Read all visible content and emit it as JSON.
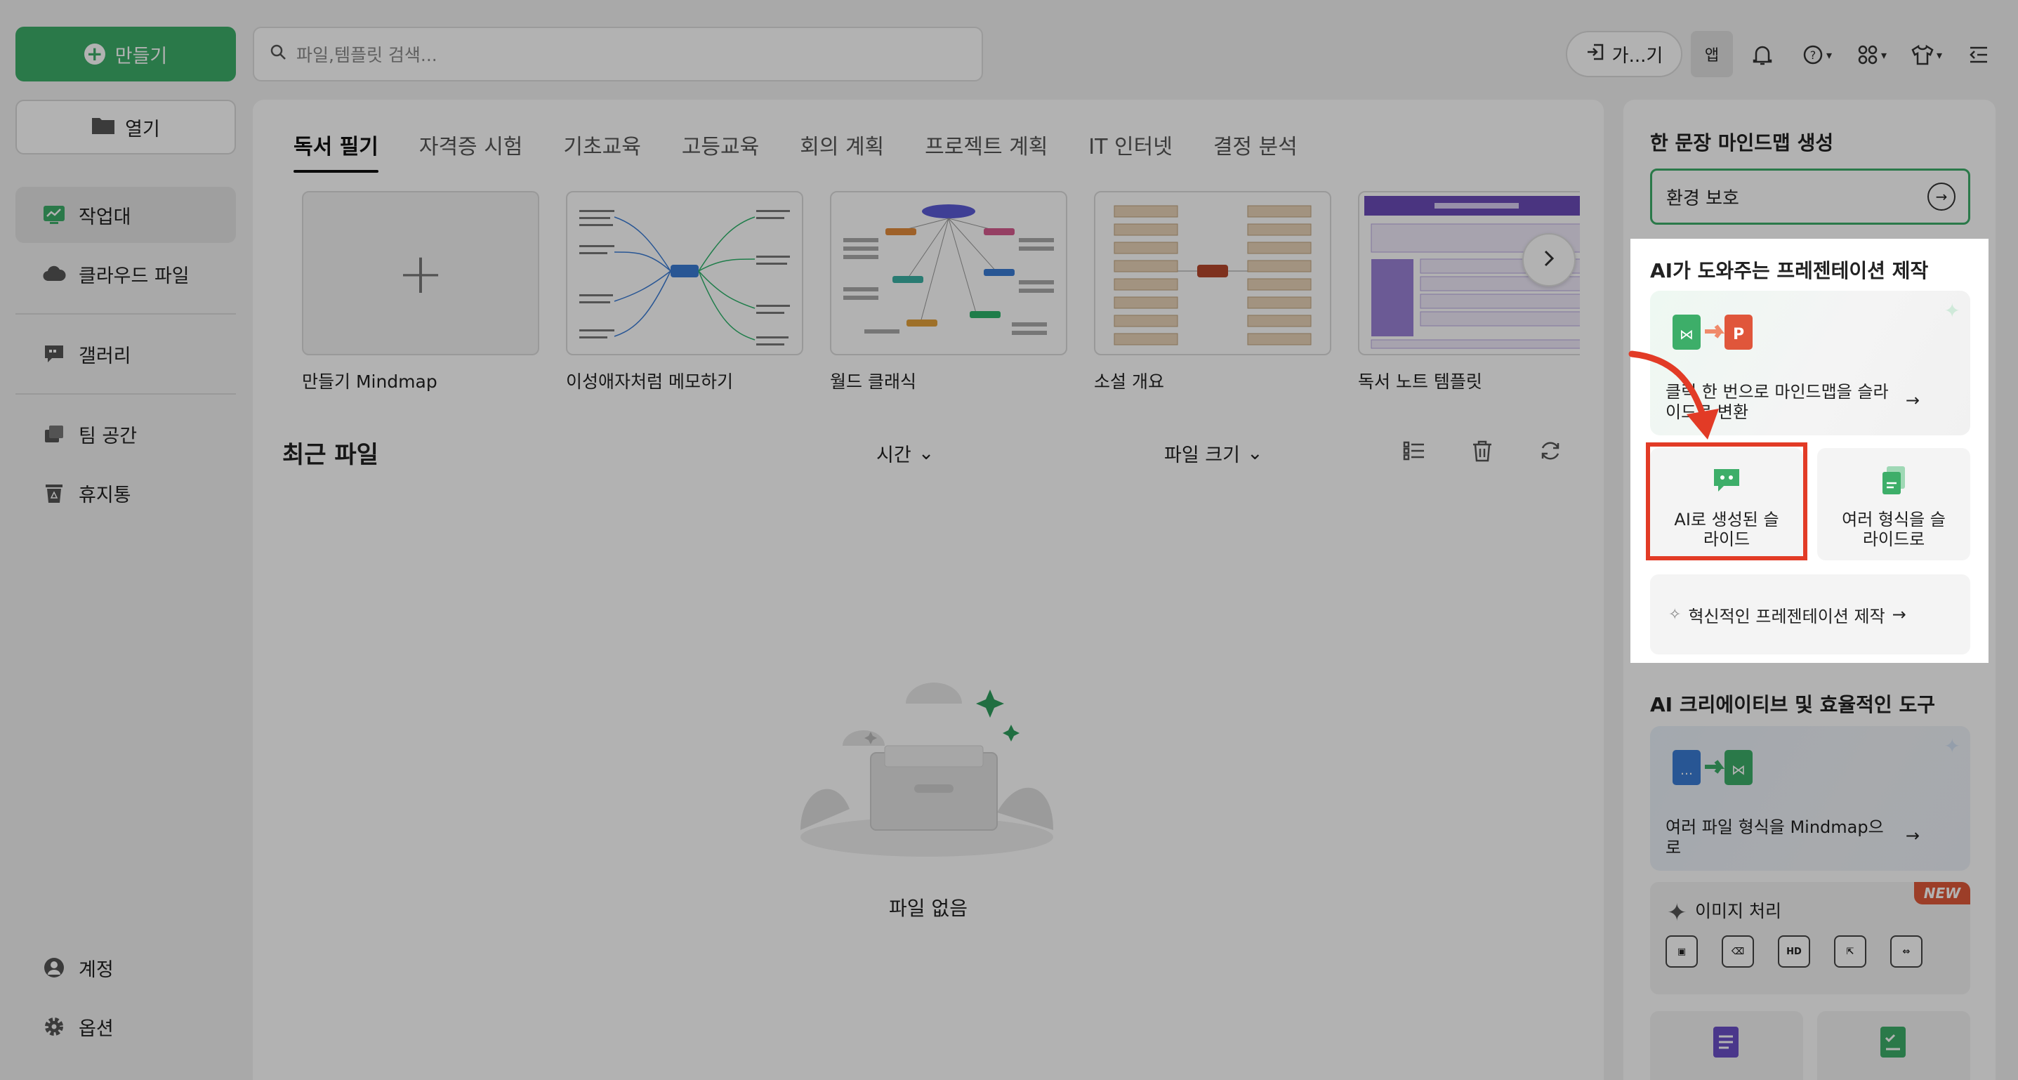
{
  "sidebar": {
    "create_label": "만들기",
    "open_label": "열기",
    "items": [
      {
        "label": "작업대",
        "icon": "workspace-icon"
      },
      {
        "label": "클라우드 파일",
        "icon": "cloud-icon"
      },
      {
        "label": "갤러리",
        "icon": "gallery-icon"
      },
      {
        "label": "팀 공간",
        "icon": "team-icon"
      },
      {
        "label": "휴지통",
        "icon": "trash-icon"
      }
    ],
    "bottom": [
      {
        "label": "계정",
        "icon": "account-icon"
      },
      {
        "label": "옵션",
        "icon": "gear-icon"
      }
    ]
  },
  "search": {
    "placeholder": "파일,템플릿 검색..."
  },
  "topbar": {
    "join_label": "가...기",
    "app_label": "앱"
  },
  "tabs": [
    "독서 필기",
    "자격증 시험",
    "기초교육",
    "고등교육",
    "회의 계획",
    "프로젝트 계획",
    "IT 인터넷",
    "결정 분석"
  ],
  "templates": [
    {
      "label": "만들기 Mindmap"
    },
    {
      "label": "이성애자처럼 메모하기"
    },
    {
      "label": "월드 클래식"
    },
    {
      "label": "소설 개요"
    },
    {
      "label": "독서 노트 템플릿"
    }
  ],
  "recent": {
    "title": "최근 파일",
    "sort_time": "시간",
    "sort_size": "파일 크기",
    "empty": "파일 없음"
  },
  "right": {
    "mindmap_heading": "한 문장 마인드맵 생성",
    "mindmap_input": "환경 보호",
    "ai_heading": "AI가 도와주는 프레젠테이션 제작",
    "convert_card": "클릭 한 번으로 마인드맵을 슬라이드로 변환",
    "ai_slides": "AI로 생성된 슬라이드",
    "multi_format": "여러 형식을 슬라이드로",
    "innovative": "혁신적인 프레젠테이션 제작",
    "tools_heading": "AI 크리에이티브 및 효율적인 도구",
    "file_convert": "여러 파일 형식을 Mindmap으로",
    "image_proc": "이미지 처리",
    "new_badge": "NEW",
    "hd_label": "HD"
  },
  "colors": {
    "accent": "#3dae69",
    "highlight": "#e23b26"
  }
}
